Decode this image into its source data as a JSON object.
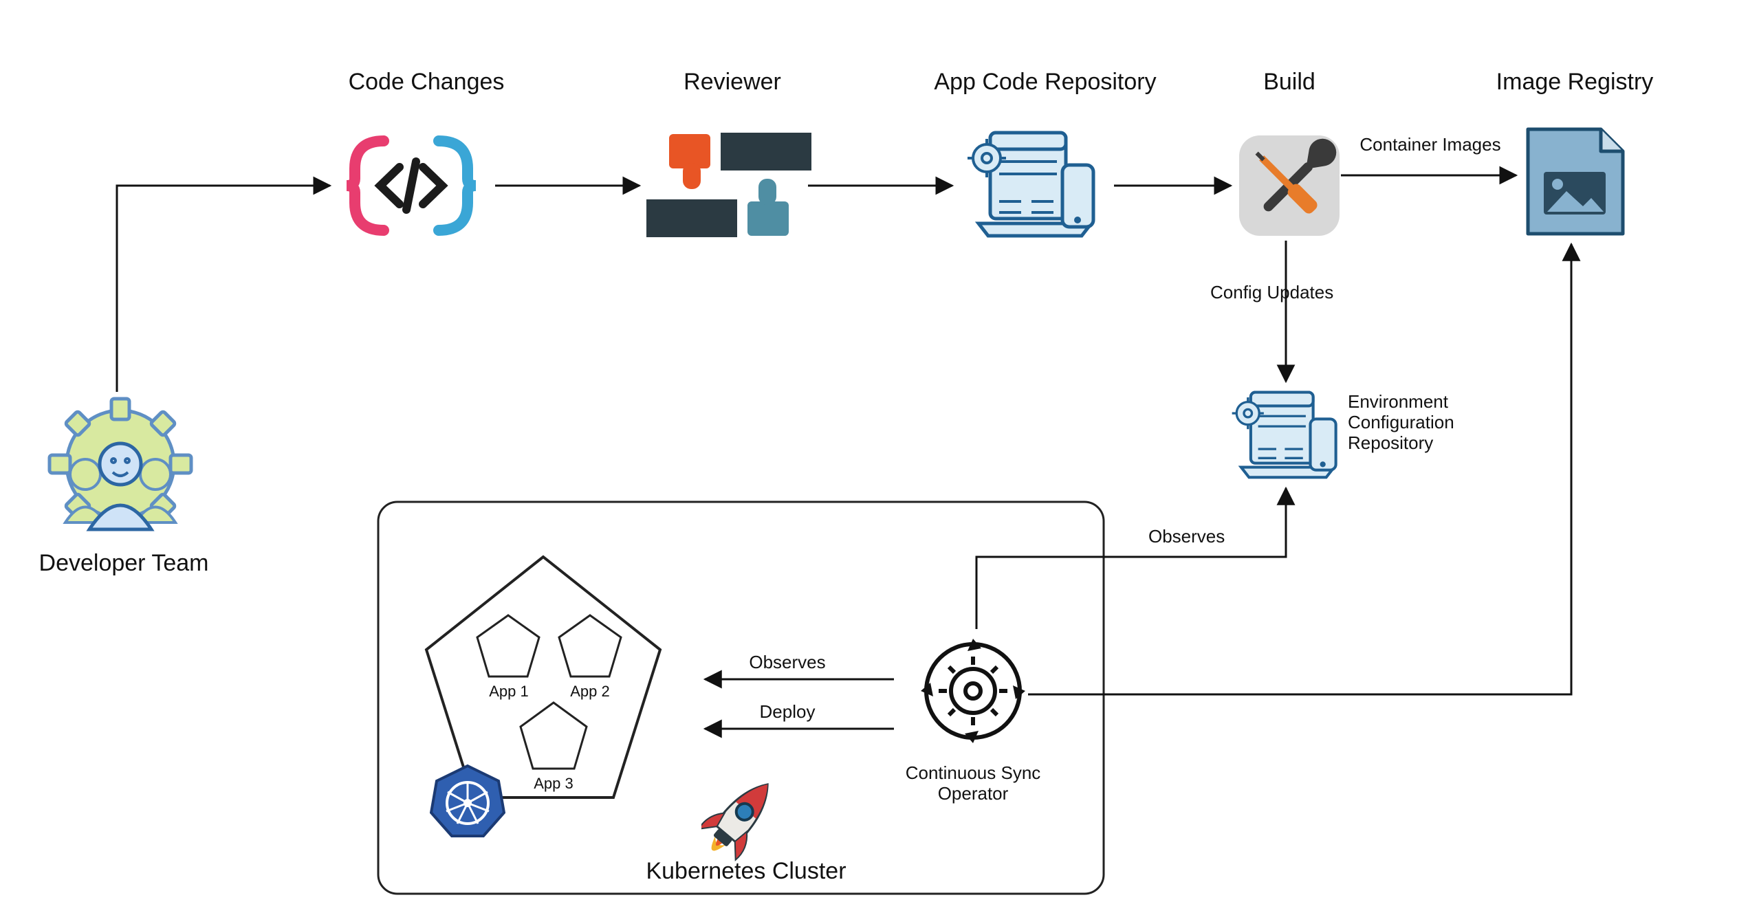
{
  "nodes": {
    "developer_team": "Developer Team",
    "code_changes": "Code Changes",
    "reviewer": "Reviewer",
    "app_code_repo": "App Code Repository",
    "build": "Build",
    "image_registry": "Image Registry",
    "env_config_repo_l1": "Environment",
    "env_config_repo_l2": "Configuration",
    "env_config_repo_l3": "Repository",
    "kubernetes_cluster": "Kubernetes Cluster",
    "continuous_sync_l1": "Continuous Sync",
    "continuous_sync_l2": "Operator",
    "app1": "App 1",
    "app2": "App 2",
    "app3": "App 3"
  },
  "edges": {
    "container_images": "Container Images",
    "config_updates": "Config Updates",
    "observes": "Observes",
    "deploy": "Deploy"
  }
}
